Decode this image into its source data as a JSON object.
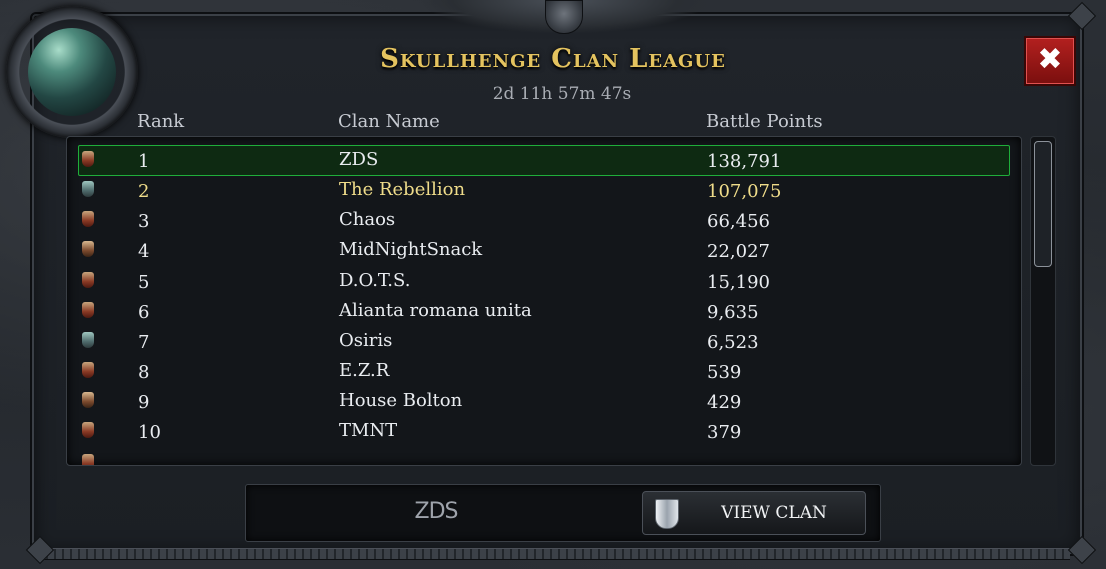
{
  "header": {
    "title": "Skullhenge Clan League",
    "timer": "2d 11h 57m 47s",
    "close_label": "✖"
  },
  "columns": {
    "rank": "Rank",
    "name": "Clan Name",
    "points": "Battle Points"
  },
  "rows": [
    {
      "rank": "1",
      "name": "ZDS",
      "points": "138,791",
      "icon": "red-banner-icon"
    },
    {
      "rank": "2",
      "name": "The Rebellion",
      "points": "107,075",
      "icon": "teal-banner-icon"
    },
    {
      "rank": "3",
      "name": "Chaos",
      "points": "66,456",
      "icon": "red-banner-icon"
    },
    {
      "rank": "4",
      "name": "MidNightSnack",
      "points": "22,027",
      "icon": "brown-banner-icon"
    },
    {
      "rank": "5",
      "name": "D.O.T.S.",
      "points": "15,190",
      "icon": "red-banner-icon"
    },
    {
      "rank": "6",
      "name": "Alianta romana unita",
      "points": "9,635",
      "icon": "red-banner-icon"
    },
    {
      "rank": "7",
      "name": "Osiris",
      "points": "6,523",
      "icon": "teal-banner-icon"
    },
    {
      "rank": "8",
      "name": "E.Z.R",
      "points": "539",
      "icon": "red-banner-icon"
    },
    {
      "rank": "9",
      "name": "House Bolton",
      "points": "429",
      "icon": "brown-banner-icon"
    },
    {
      "rank": "10",
      "name": "TMNT",
      "points": "379",
      "icon": "red-banner-icon"
    }
  ],
  "selected": {
    "name": "ZDS",
    "view_label": "VIEW CLAN"
  },
  "colors": {
    "title": "#e4c35f",
    "selected_border": "#1fae3a",
    "highlight_text": "#efdc8a",
    "close_button": "#b3201f"
  }
}
